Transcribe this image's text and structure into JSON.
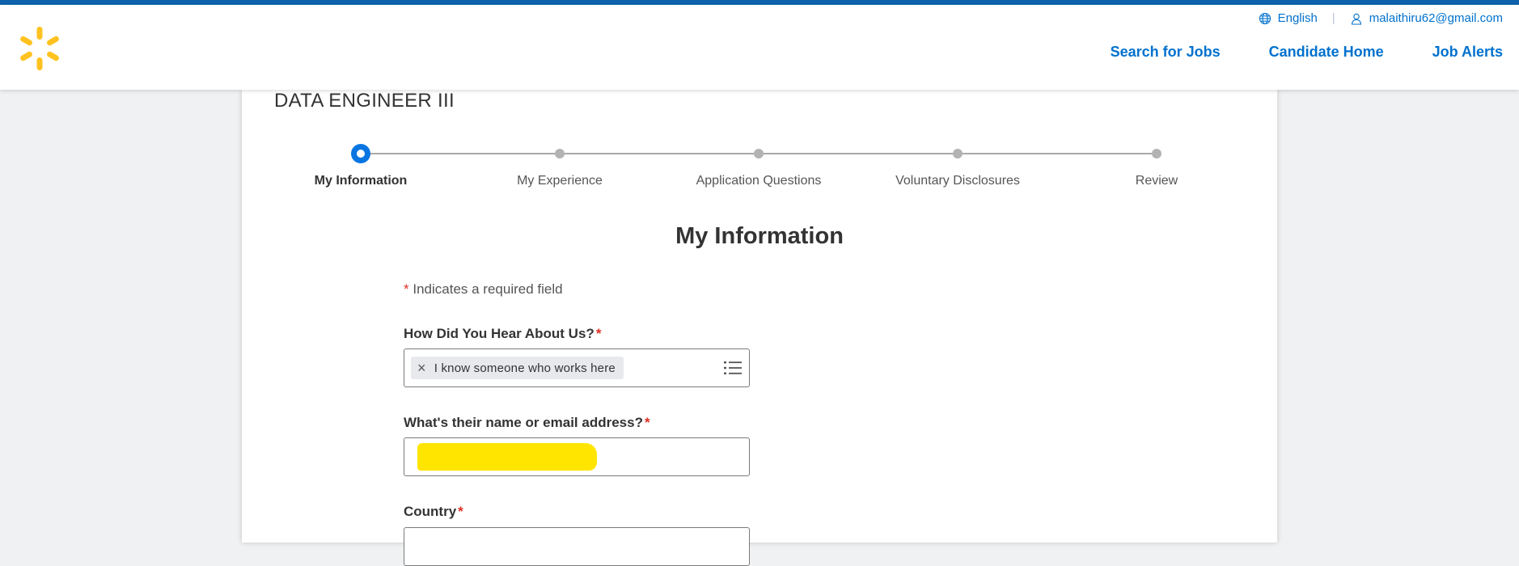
{
  "header": {
    "language_label": "English",
    "separator": "|",
    "user_email": "malaithiru62@gmail.com",
    "nav": {
      "search_jobs": "Search for Jobs",
      "candidate_home": "Candidate Home",
      "job_alerts": "Job Alerts"
    },
    "logo_color": "#ffc220",
    "link_color": "#0071ce",
    "stripe_color": "#0d62ab"
  },
  "job_title": "DATA ENGINEER III",
  "steps": [
    {
      "label": "My Information",
      "active": true
    },
    {
      "label": "My Experience",
      "active": false
    },
    {
      "label": "Application Questions",
      "active": false
    },
    {
      "label": "Voluntary Disclosures",
      "active": false
    },
    {
      "label": "Review",
      "active": false
    }
  ],
  "form": {
    "section_title": "My Information",
    "required_star": "*",
    "required_note": "Indicates a required field",
    "how_heard": {
      "label": "How Did You Hear About Us?",
      "selected": "I know someone who works here",
      "remove_glyph": "×"
    },
    "referrer": {
      "label": "What's their name or email address?",
      "value_redacted": true
    },
    "country": {
      "label": "Country"
    }
  }
}
